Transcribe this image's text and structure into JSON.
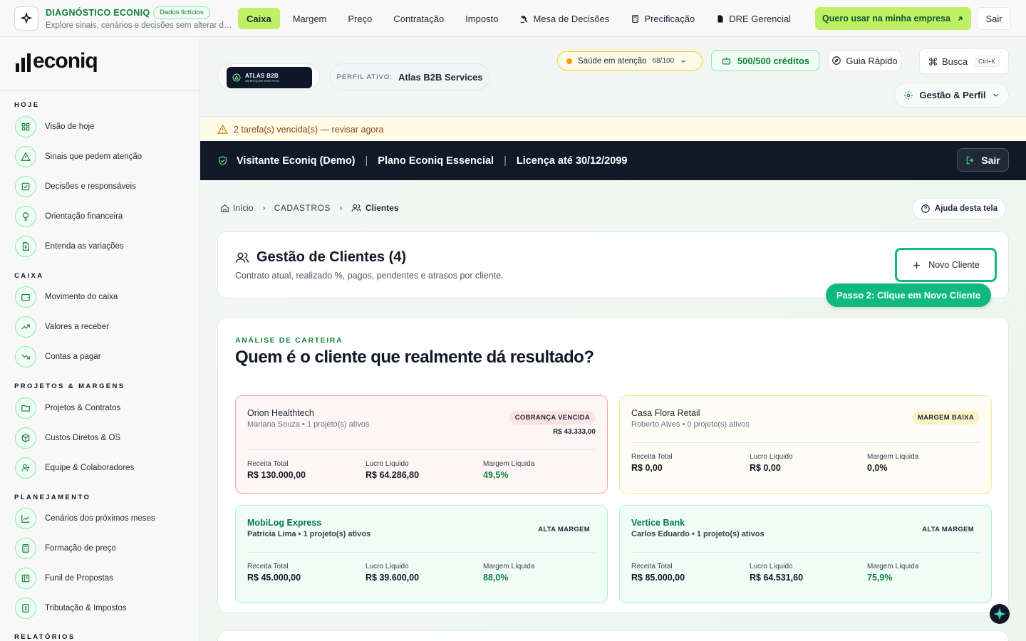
{
  "topbar": {
    "diag_title": "DIAGNÓSTICO ECONIQ",
    "diag_badge": "Dados fictícios",
    "diag_subtitle": "Explore sinais, cenários e decisões sem alterar dados reais",
    "nav": [
      {
        "label": "Caixa",
        "active": true
      },
      {
        "label": "Margem"
      },
      {
        "label": "Preço"
      },
      {
        "label": "Contratação"
      },
      {
        "label": "Imposto"
      },
      {
        "label": "Mesa de Decisões",
        "icon": "gavel-icon"
      },
      {
        "label": "Precificação",
        "icon": "calculator-icon"
      },
      {
        "label": "DRE Gerencial",
        "icon": "file-icon"
      }
    ],
    "cta_label": "Quero usar na minha empresa",
    "exit_label": "Sair"
  },
  "sidebar": {
    "logo_text": "econiq",
    "sections": [
      {
        "title": "HOJE",
        "items": [
          "Visão de hoje",
          "Sinais que pedem atenção",
          "Decisões e responsáveis",
          "Orientação financeira",
          "Entenda as variações"
        ]
      },
      {
        "title": "CAIXA",
        "items": [
          "Movimento do caixa",
          "Valores a receber",
          "Contas a pagar"
        ]
      },
      {
        "title": "PROJETOS & MARGENS",
        "items": [
          "Projetos & Contratos",
          "Custos Diretos & OS",
          "Equipe & Colaboradores"
        ]
      },
      {
        "title": "PLANEJAMENTO",
        "items": [
          "Cenários dos próximos meses",
          "Formação de preço",
          "Funil de Propostas",
          "Tributação & Impostos"
        ]
      },
      {
        "title": "RELATÓRIOS",
        "items": []
      }
    ]
  },
  "header": {
    "atlas_logo_main": "ATLAS B2B",
    "atlas_logo_sub": "SERVIÇOS DIGITAIS",
    "perfil_label": "PERFIL ATIVO:",
    "perfil_value": "Atlas B2B Services",
    "saude_label": "Saúde em atenção",
    "saude_score": "68/100",
    "creditos_label": "500/500 créditos",
    "guia_label": "Guia Rápido",
    "busca_label": "Busca",
    "busca_shortcut": "Ctrl+K",
    "gestao_label": "Gestão & Perfil"
  },
  "alert": {
    "text": "2 tarefa(s) vencida(s) — revisar agora"
  },
  "license": {
    "visitor": "Visitante Econiq (Demo)",
    "plan": "Plano Econiq Essencial",
    "valid": "Licença até 30/12/2099",
    "exit_label": "Sair"
  },
  "breadcrumb": {
    "home": "Início",
    "section": "CADASTROS",
    "current": "Clientes"
  },
  "help_label": "Ajuda desta tela",
  "clients": {
    "title": "Gestão de Clientes (4)",
    "subtitle": "Contrato atual, realizado %, pagos, pendentes e atrasos por cliente.",
    "new_button": "Novo Cliente",
    "tooltip": "Passo 2: Clique em Novo Cliente"
  },
  "analysis": {
    "eyebrow": "ANÁLISE DE CARTEIRA",
    "title": "Quem é o cliente que realmente dá resultado?",
    "metric_labels": {
      "revenue": "Receita Total",
      "profit": "Lucro Líquido",
      "margin": "Margem Líquida"
    },
    "cards": [
      {
        "name": "Orion Healthtech",
        "meta": "Mariana Souza • 1 projeto(s) ativos",
        "badge": "COBRANÇA VENCIDA",
        "amount": "R$ 43.333,00",
        "revenue": "R$ 130.000,00",
        "profit": "R$ 64.286,80",
        "margin": "49,5%",
        "tone": "red"
      },
      {
        "name": "Casa Flora Retail",
        "meta": "Roberto Alves • 0 projeto(s) ativos",
        "badge": "MARGEM BAIXA",
        "revenue": "R$ 0,00",
        "profit": "R$ 0,00",
        "margin": "0,0%",
        "tone": "yellow"
      },
      {
        "name": "MobiLog Express",
        "meta": "Patricia Lima • 1 projeto(s) ativos",
        "badge": "ALTA MARGEM",
        "revenue": "R$ 45.000,00",
        "profit": "R$ 39.600,00",
        "margin": "88,0%",
        "tone": "green"
      },
      {
        "name": "Vertice Bank",
        "meta": "Carlos Eduardo • 1 projeto(s) ativos",
        "badge": "ALTA MARGEM",
        "revenue": "R$ 85.000,00",
        "profit": "R$ 64.531,60",
        "margin": "75,9%",
        "tone": "green"
      }
    ]
  },
  "colors": {
    "accent_lime": "#bef264",
    "brand_green": "#15803d",
    "cta_green": "#10b981",
    "dark_bar": "#111827"
  }
}
